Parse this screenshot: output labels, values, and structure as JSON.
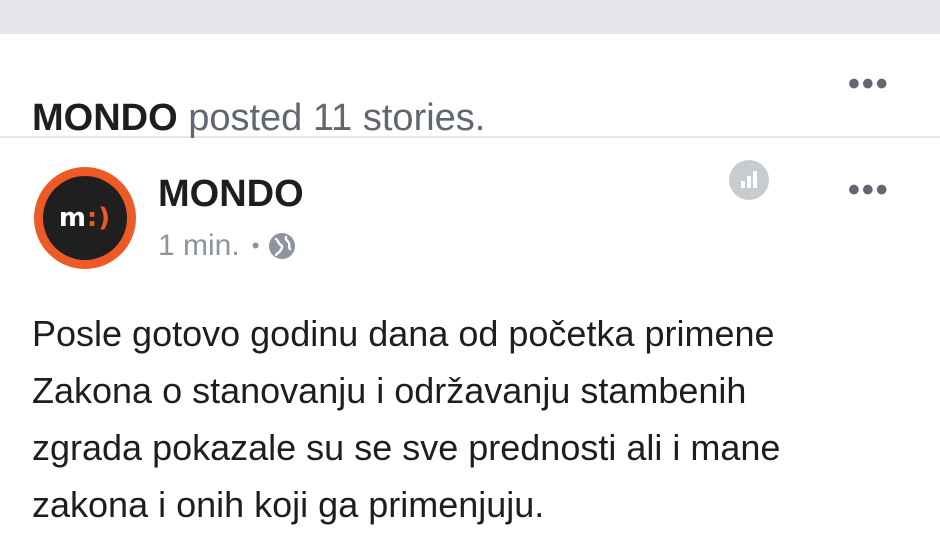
{
  "story": {
    "author": "MONDO",
    "action_text": "posted 11 stories."
  },
  "post": {
    "page_name": "MONDO",
    "avatar_text": "m",
    "avatar_smile": ":)",
    "timestamp": "1 min.",
    "separator": "•",
    "privacy_icon": "globe-icon",
    "lines": [
      "Posle gotovo godinu dana od početka primene",
      "Zakona o stanovanju i održavanju stambenih",
      "zgrada pokazale su se sve prednosti ali i mane",
      "zakona i onih koji ga primenjuju."
    ]
  },
  "menu": {
    "more_label": "•••"
  },
  "icons": {
    "insights": "bar-chart-icon",
    "more": "more-options-icon"
  },
  "colors": {
    "brand_orange": "#ee5a25",
    "avatar_dark": "#1f1f1f",
    "muted_text": "#8d949e",
    "divider": "#e4e6eb"
  }
}
